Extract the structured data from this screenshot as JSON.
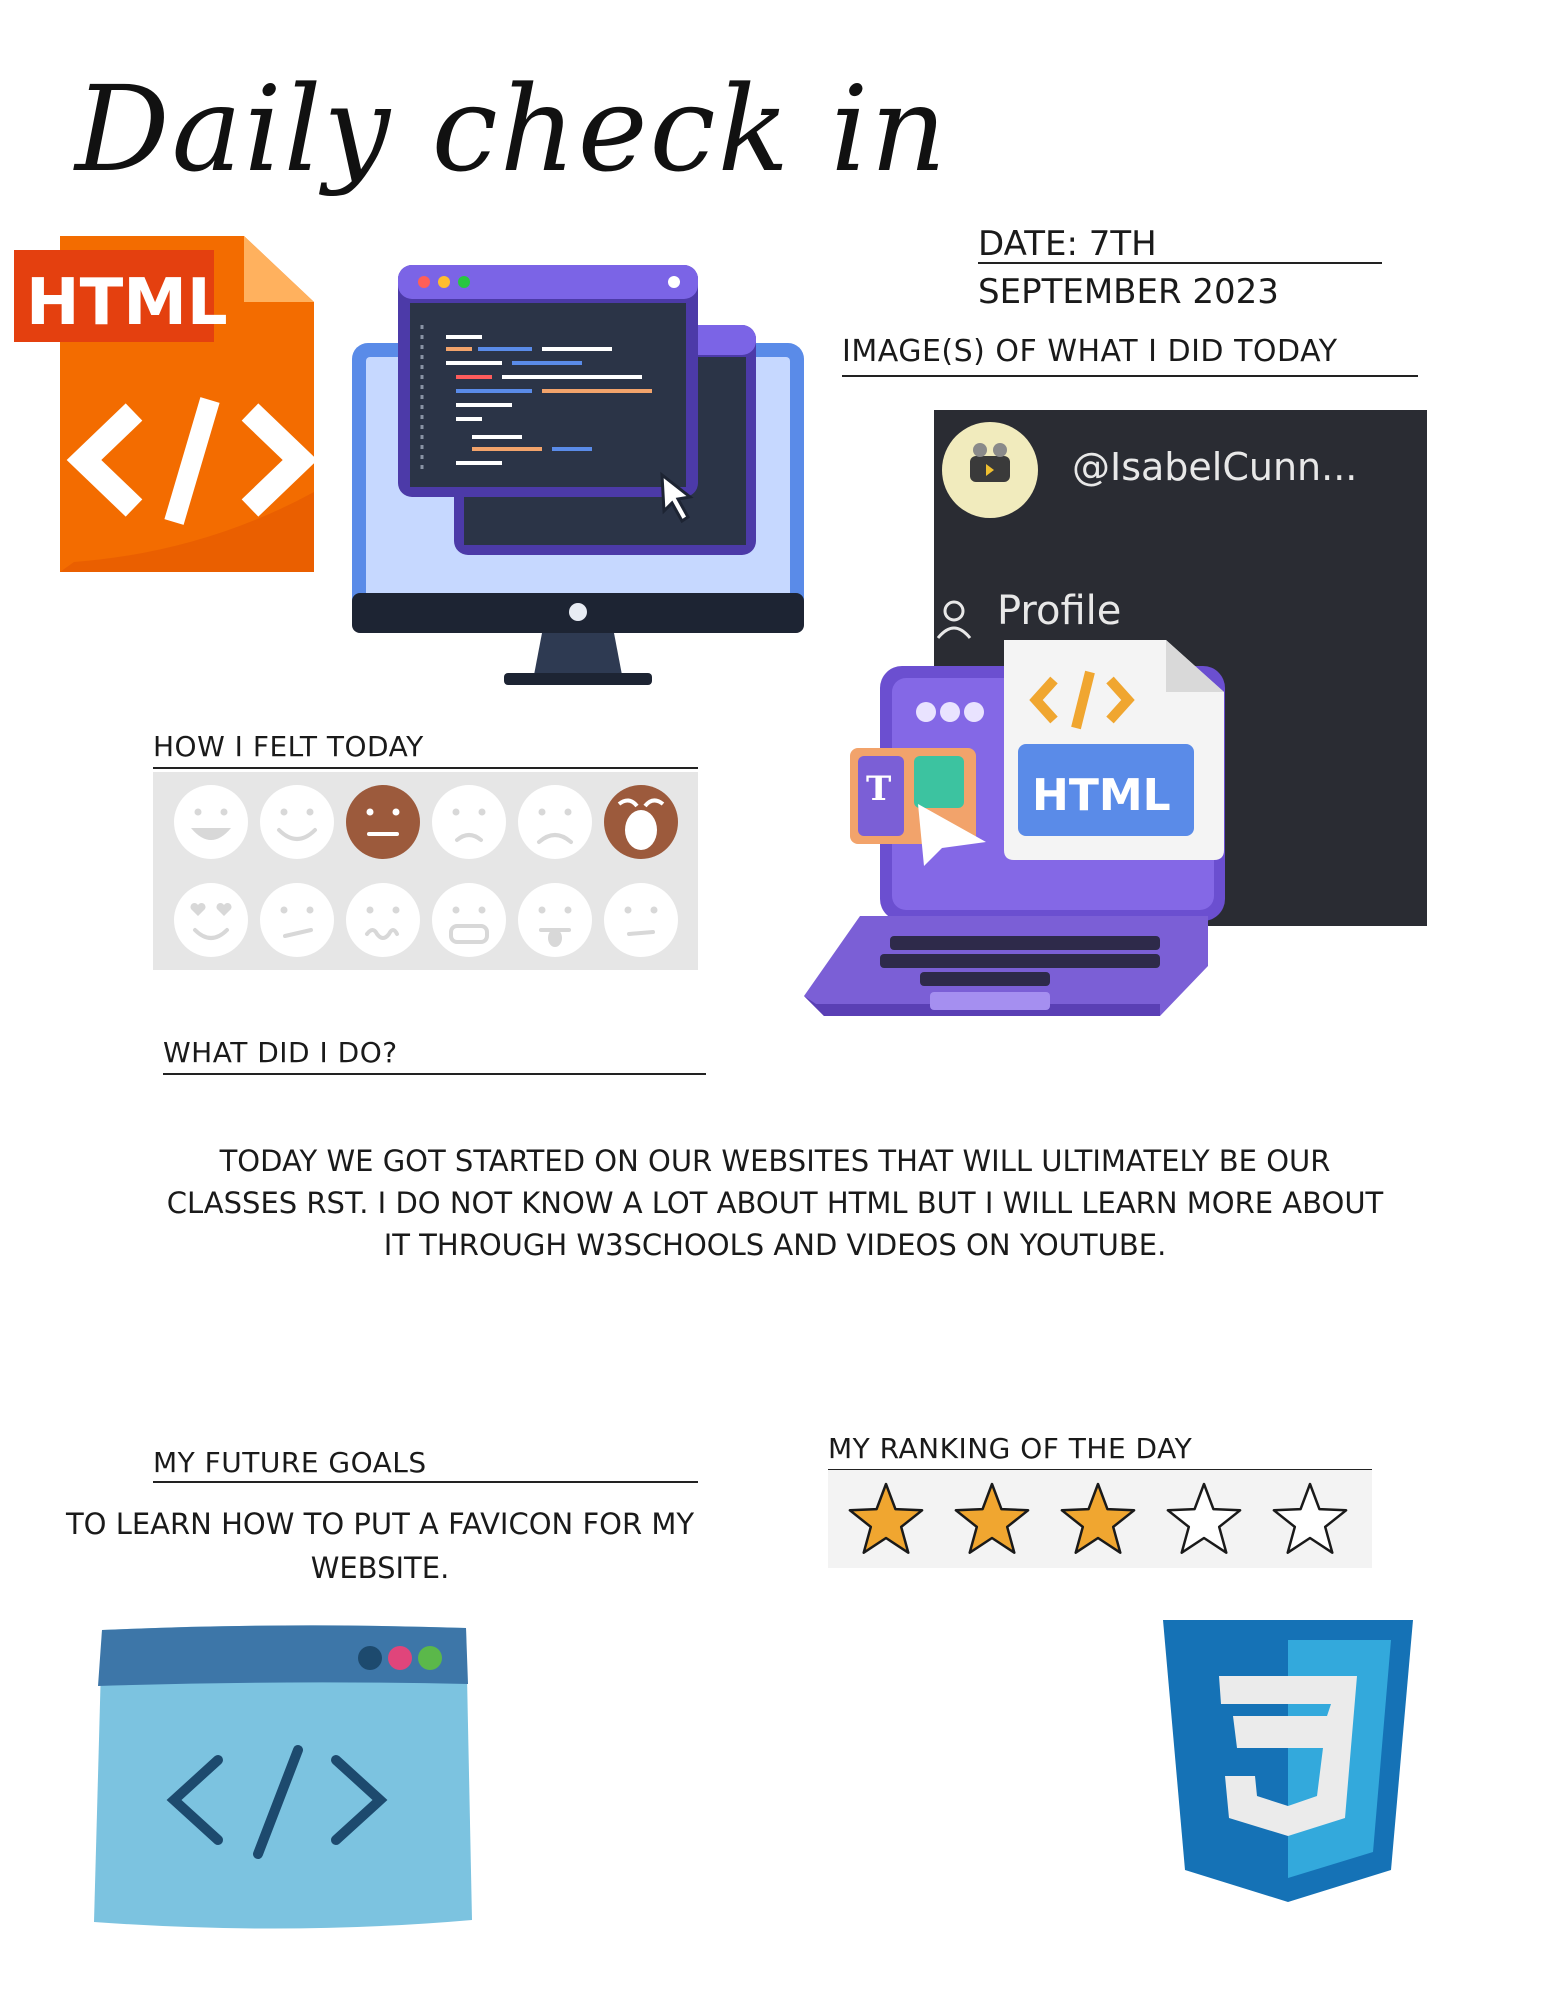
{
  "title": "Daily check in",
  "date": {
    "line1": "DATE: 7TH",
    "line2": "SEPTEMBER 2023"
  },
  "images_label": "IMAGE(S) OF WHAT I DID  TODAY",
  "screenshot": {
    "handle": "@IsabelCunn...",
    "menu_item": "Profile"
  },
  "felt_label": "HOW I FELT TODAY",
  "moods": [
    {
      "face": "grin",
      "selected": false
    },
    {
      "face": "smile",
      "selected": false
    },
    {
      "face": "neutral",
      "selected": true
    },
    {
      "face": "worried",
      "selected": false
    },
    {
      "face": "sad",
      "selected": false
    },
    {
      "face": "crying",
      "selected": true
    },
    {
      "face": "heart-eyes",
      "selected": false
    },
    {
      "face": "skeptical",
      "selected": false
    },
    {
      "face": "woozy",
      "selected": false
    },
    {
      "face": "angry",
      "selected": false
    },
    {
      "face": "tongue-out",
      "selected": false
    },
    {
      "face": "unamused",
      "selected": false
    }
  ],
  "did_label": "WHAT DID I DO?",
  "did_text": "TODAY WE GOT STARTED ON OUR WEBSITES THAT WILL ULTIMATELY BE OUR CLASSES RST. I DO NOT KNOW A LOT ABOUT HTML BUT I WILL LEARN MORE ABOUT IT THROUGH W3SCHOOLS AND VIDEOS ON YOUTUBE.",
  "goals_label": "MY FUTURE GOALS",
  "goals_text": "TO LEARN HOW TO PUT A FAVICON FOR MY WEBSITE.",
  "ranking_label": "MY RANKING OF THE DAY",
  "rating": {
    "value": 3,
    "max": 5
  },
  "colors": {
    "html_orange": "#f36c00",
    "html_red": "#e4400f",
    "star_gold": "#f0a630",
    "mood_selected": "#9c5a3c",
    "css_blue": "#1572b6",
    "css_light_blue": "#33a9dc",
    "laptop_purple": "#7b5fd6",
    "panel_dark": "#2a2c33"
  },
  "icons": {
    "html_file": "html-file-icon",
    "monitor": "code-monitor-icon",
    "laptop": "html-laptop-icon",
    "browser": "code-browser-icon",
    "css": "css3-shield-icon",
    "avatar": "avatar-icon",
    "user": "user-icon"
  },
  "artwork_text": {
    "html_badge": "HTML",
    "laptop_html": "HTML",
    "laptop_t": "T",
    "css_number": "3"
  }
}
